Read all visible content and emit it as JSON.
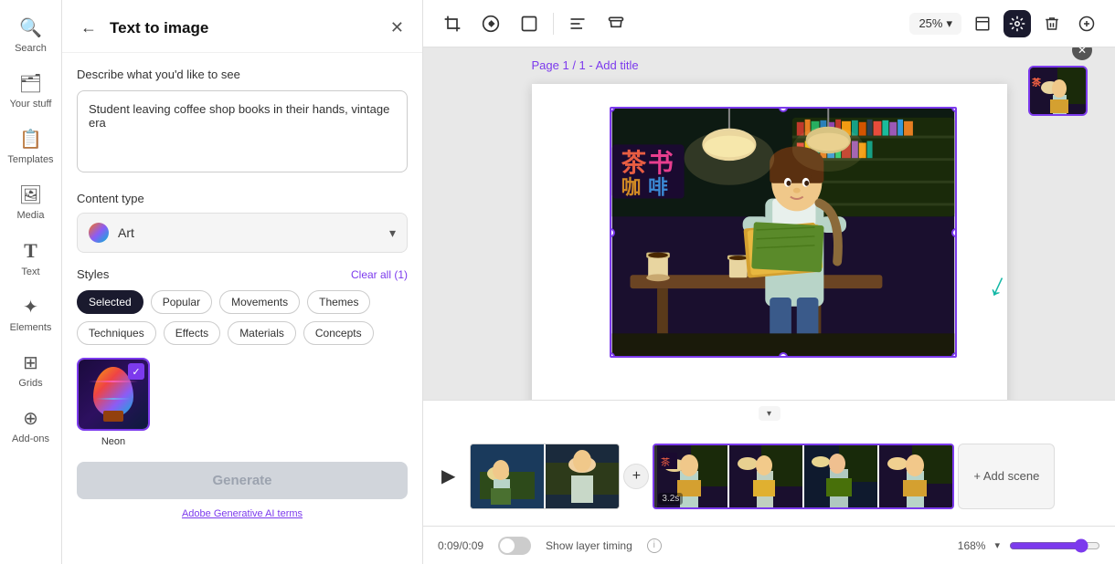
{
  "sidebar": {
    "items": [
      {
        "id": "search",
        "label": "Search",
        "icon": "🔍"
      },
      {
        "id": "your-stuff",
        "label": "Your stuff",
        "icon": "🗂"
      },
      {
        "id": "templates",
        "label": "Templates",
        "icon": "📋"
      },
      {
        "id": "media",
        "label": "Media",
        "icon": "🖼"
      },
      {
        "id": "text",
        "label": "Text",
        "icon": "T"
      },
      {
        "id": "elements",
        "label": "Elements",
        "icon": "✦"
      },
      {
        "id": "grids",
        "label": "Grids",
        "icon": "⊞"
      },
      {
        "id": "add-ons",
        "label": "Add-ons",
        "icon": "⊕"
      }
    ]
  },
  "panel": {
    "title": "Text to image",
    "back_label": "←",
    "close_label": "✕",
    "describe_label": "Describe what you'd like to see",
    "prompt_text": "Student leaving coffee shop books in their hands, vintage era",
    "content_type_label": "Content type",
    "content_type_value": "Art",
    "styles_label": "Styles",
    "clear_all_label": "Clear all (1)",
    "style_tags": [
      {
        "label": "Selected",
        "active": true
      },
      {
        "label": "Popular",
        "active": false
      },
      {
        "label": "Movements",
        "active": false
      },
      {
        "label": "Themes",
        "active": false
      },
      {
        "label": "Techniques",
        "active": false
      },
      {
        "label": "Effects",
        "active": false
      },
      {
        "label": "Materials",
        "active": false
      },
      {
        "label": "Concepts",
        "active": false
      }
    ],
    "style_thumbnails": [
      {
        "label": "Neon",
        "selected": true
      }
    ],
    "generate_label": "Generate",
    "ai_terms_label": "Adobe Generative AI terms"
  },
  "toolbar": {
    "zoom_value": "25%",
    "icons": [
      "crop",
      "rotate",
      "square",
      "align",
      "translate"
    ]
  },
  "canvas": {
    "page_label": "Page 1 / 1 -",
    "add_title_label": "Add title",
    "image_alt": "Student leaving coffee shop books in their hands, vintage era"
  },
  "timeline": {
    "play_icon": "▶",
    "time_display": "0:09/0:09",
    "show_layer_label": "Show layer timing",
    "scene_label": "3.2s",
    "add_scene_label": "+ Add scene",
    "zoom_percent": "168%"
  }
}
